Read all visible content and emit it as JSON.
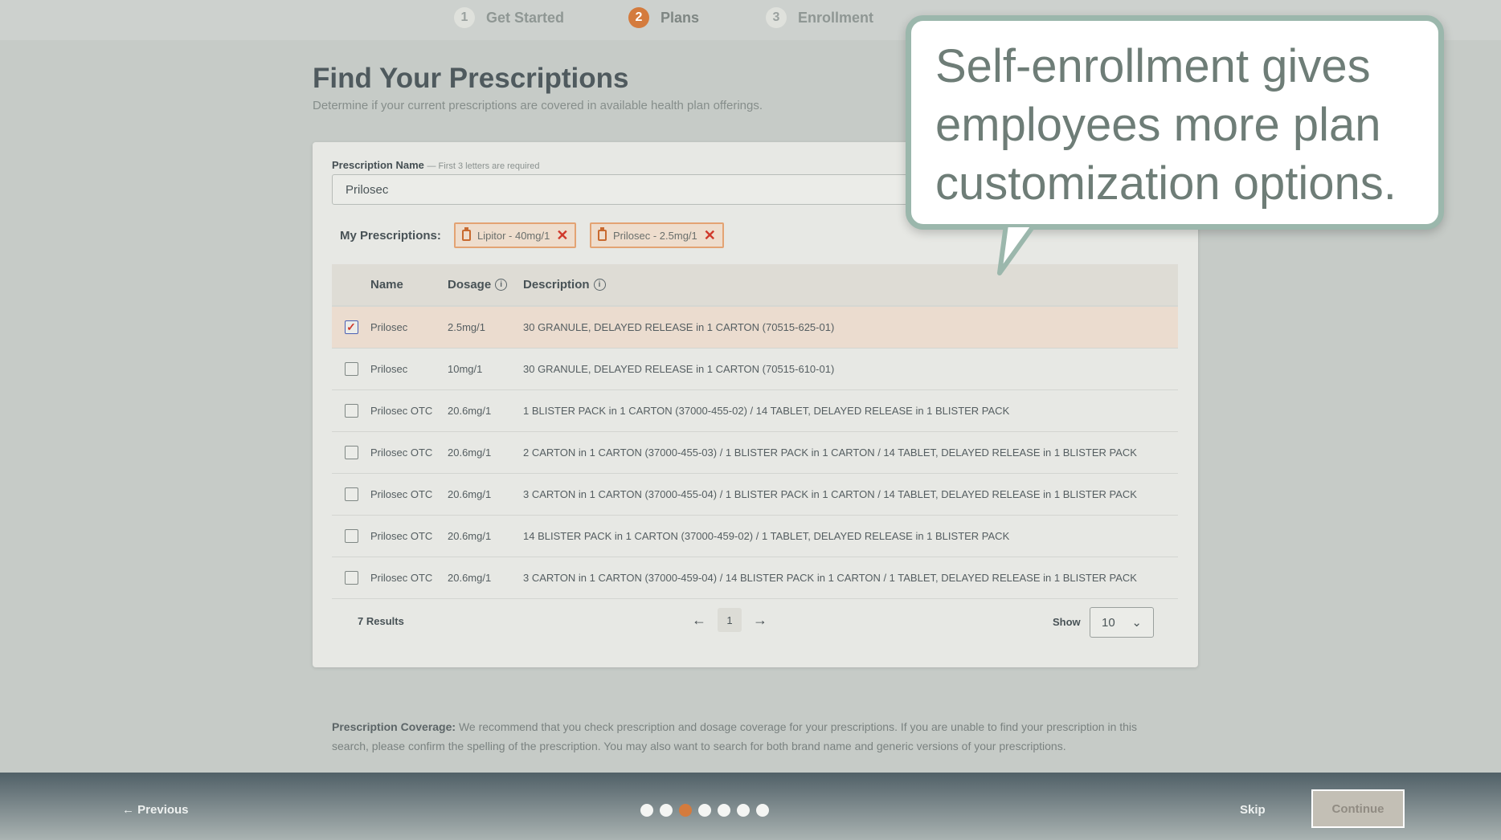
{
  "stepper": {
    "steps": [
      {
        "num": "1",
        "label": "Get Started"
      },
      {
        "num": "2",
        "label": "Plans"
      },
      {
        "num": "3",
        "label": "Enrollment"
      }
    ]
  },
  "page": {
    "title": "Find Your Prescriptions",
    "subtitle": "Determine if your current prescriptions are covered in available health plan offerings."
  },
  "search": {
    "label": "Prescription Name",
    "hint": "— First 3 letters are required",
    "value": "Prilosec"
  },
  "my_prescriptions": {
    "label": "My Prescriptions:",
    "chips": [
      "Lipitor - 40mg/1",
      "Prilosec - 2.5mg/1"
    ]
  },
  "table": {
    "headers": {
      "name": "Name",
      "dosage": "Dosage",
      "description": "Description"
    },
    "rows": [
      {
        "checked": true,
        "name": "Prilosec",
        "dosage": "2.5mg/1",
        "description": "30 GRANULE, DELAYED RELEASE in 1 CARTON (70515-625-01)"
      },
      {
        "checked": false,
        "name": "Prilosec",
        "dosage": "10mg/1",
        "description": "30 GRANULE, DELAYED RELEASE in 1 CARTON (70515-610-01)"
      },
      {
        "checked": false,
        "name": "Prilosec OTC",
        "dosage": "20.6mg/1",
        "description": "1 BLISTER PACK in 1 CARTON (37000-455-02) / 14 TABLET, DELAYED RELEASE in 1 BLISTER PACK"
      },
      {
        "checked": false,
        "name": "Prilosec OTC",
        "dosage": "20.6mg/1",
        "description": "2 CARTON in 1 CARTON (37000-455-03) / 1 BLISTER PACK in 1 CARTON / 14 TABLET, DELAYED RELEASE in 1 BLISTER PACK"
      },
      {
        "checked": false,
        "name": "Prilosec OTC",
        "dosage": "20.6mg/1",
        "description": "3 CARTON in 1 CARTON (37000-455-04) / 1 BLISTER PACK in 1 CARTON / 14 TABLET, DELAYED RELEASE in 1 BLISTER PACK"
      },
      {
        "checked": false,
        "name": "Prilosec OTC",
        "dosage": "20.6mg/1",
        "description": "14 BLISTER PACK in 1 CARTON (37000-459-02) / 1 TABLET, DELAYED RELEASE in 1 BLISTER PACK"
      },
      {
        "checked": false,
        "name": "Prilosec OTC",
        "dosage": "20.6mg/1",
        "description": "3 CARTON in 1 CARTON (37000-459-04) / 14 BLISTER PACK in 1 CARTON / 1 TABLET, DELAYED RELEASE in 1 BLISTER PACK"
      }
    ]
  },
  "pagination": {
    "results": "7 Results",
    "prev_arrow": "←",
    "next_arrow": "→",
    "current_page": "1",
    "show_label": "Show",
    "show_value": "10"
  },
  "coverage_note": {
    "label": "Prescription Coverage:",
    "text": "We recommend that you check prescription and dosage coverage for your prescriptions. If you are unable to find your prescription in this search, please confirm the spelling of the prescription. You may also want to search for both brand name and generic versions of your prescriptions."
  },
  "footer": {
    "previous_label": "← Previous",
    "skip_label": "Skip",
    "continue_label": "Continue",
    "progress_dots": 7,
    "active_dot": 3
  },
  "callout": {
    "text": "Self-enrollment gives employees more plan customization options."
  },
  "colors": {
    "accent": "#d47b3d",
    "remove_x": "#d0392b",
    "callout_border": "#9bb7ac",
    "callout_text": "#6e7d77"
  }
}
